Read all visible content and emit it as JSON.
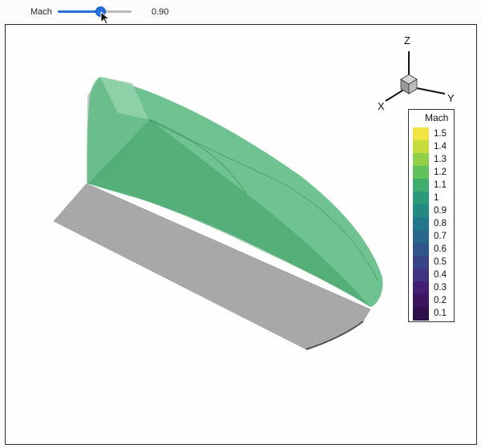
{
  "slider": {
    "label": "Mach",
    "value": 0.9,
    "value_text": "0.90",
    "fill_fraction": 0.58,
    "color": "#1f6fe0"
  },
  "axes": {
    "x": "X",
    "y": "Y",
    "z": "Z"
  },
  "legend": {
    "title": "Mach",
    "ticks": [
      "1.5",
      "1.4",
      "1.3",
      "1.2",
      "1.1",
      "1",
      "0.9",
      "0.8",
      "0.7",
      "0.6",
      "0.5",
      "0.4",
      "0.3",
      "0.2",
      "0.1"
    ],
    "colors": [
      "#f0e442",
      "#c5dd3b",
      "#92cf48",
      "#62c25a",
      "#3dae6e",
      "#2a9a7a",
      "#238a82",
      "#22788a",
      "#26688c",
      "#2f568b",
      "#384487",
      "#3f3280",
      "#421f72",
      "#3d1460",
      "#2e1048"
    ]
  },
  "icons": {
    "cursor": "arrow-cursor-icon",
    "orientation": "orientation-cube-icon"
  },
  "colors": {
    "surface": "#5fbd85",
    "plate": "#a8a8a8",
    "background": "#fefefe"
  }
}
